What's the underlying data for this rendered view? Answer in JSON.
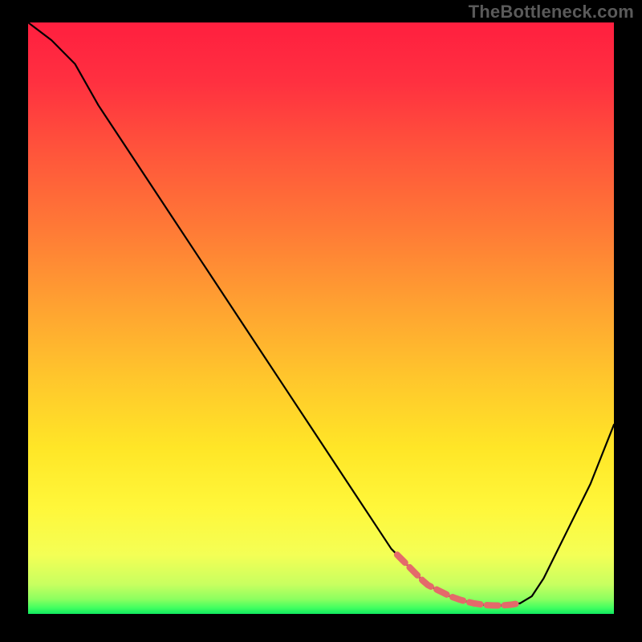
{
  "watermark": "TheBottleneck.com",
  "chart_data": {
    "type": "line",
    "title": "",
    "xlabel": "",
    "ylabel": "",
    "xlim": [
      0,
      100
    ],
    "ylim": [
      0,
      100
    ],
    "x": [
      0,
      4,
      8,
      12,
      16,
      20,
      24,
      28,
      32,
      36,
      40,
      44,
      48,
      52,
      56,
      60,
      62,
      64,
      66,
      68,
      70,
      72,
      74,
      76,
      78,
      80,
      82,
      84,
      86,
      88,
      90,
      92,
      94,
      96,
      98,
      100
    ],
    "y": [
      100,
      97,
      93,
      86,
      80,
      74,
      68,
      62,
      56,
      50,
      44,
      38,
      32,
      26,
      20,
      14,
      11,
      9,
      7,
      5,
      4,
      3,
      2.3,
      1.8,
      1.5,
      1.4,
      1.5,
      1.8,
      3,
      6,
      10,
      14,
      18,
      22,
      27,
      32
    ],
    "sweet_spot": {
      "x_start": 63,
      "x_end": 84
    },
    "gradient_stops": [
      {
        "offset": 0.0,
        "color": "#ff1f3f"
      },
      {
        "offset": 0.1,
        "color": "#ff3040"
      },
      {
        "offset": 0.22,
        "color": "#ff553b"
      },
      {
        "offset": 0.35,
        "color": "#ff7a36"
      },
      {
        "offset": 0.48,
        "color": "#ffa231"
      },
      {
        "offset": 0.6,
        "color": "#ffc62c"
      },
      {
        "offset": 0.72,
        "color": "#ffe627"
      },
      {
        "offset": 0.82,
        "color": "#fff73a"
      },
      {
        "offset": 0.9,
        "color": "#f4ff55"
      },
      {
        "offset": 0.95,
        "color": "#c8ff60"
      },
      {
        "offset": 0.975,
        "color": "#8cff60"
      },
      {
        "offset": 0.99,
        "color": "#40ff60"
      },
      {
        "offset": 1.0,
        "color": "#10e860"
      }
    ]
  }
}
